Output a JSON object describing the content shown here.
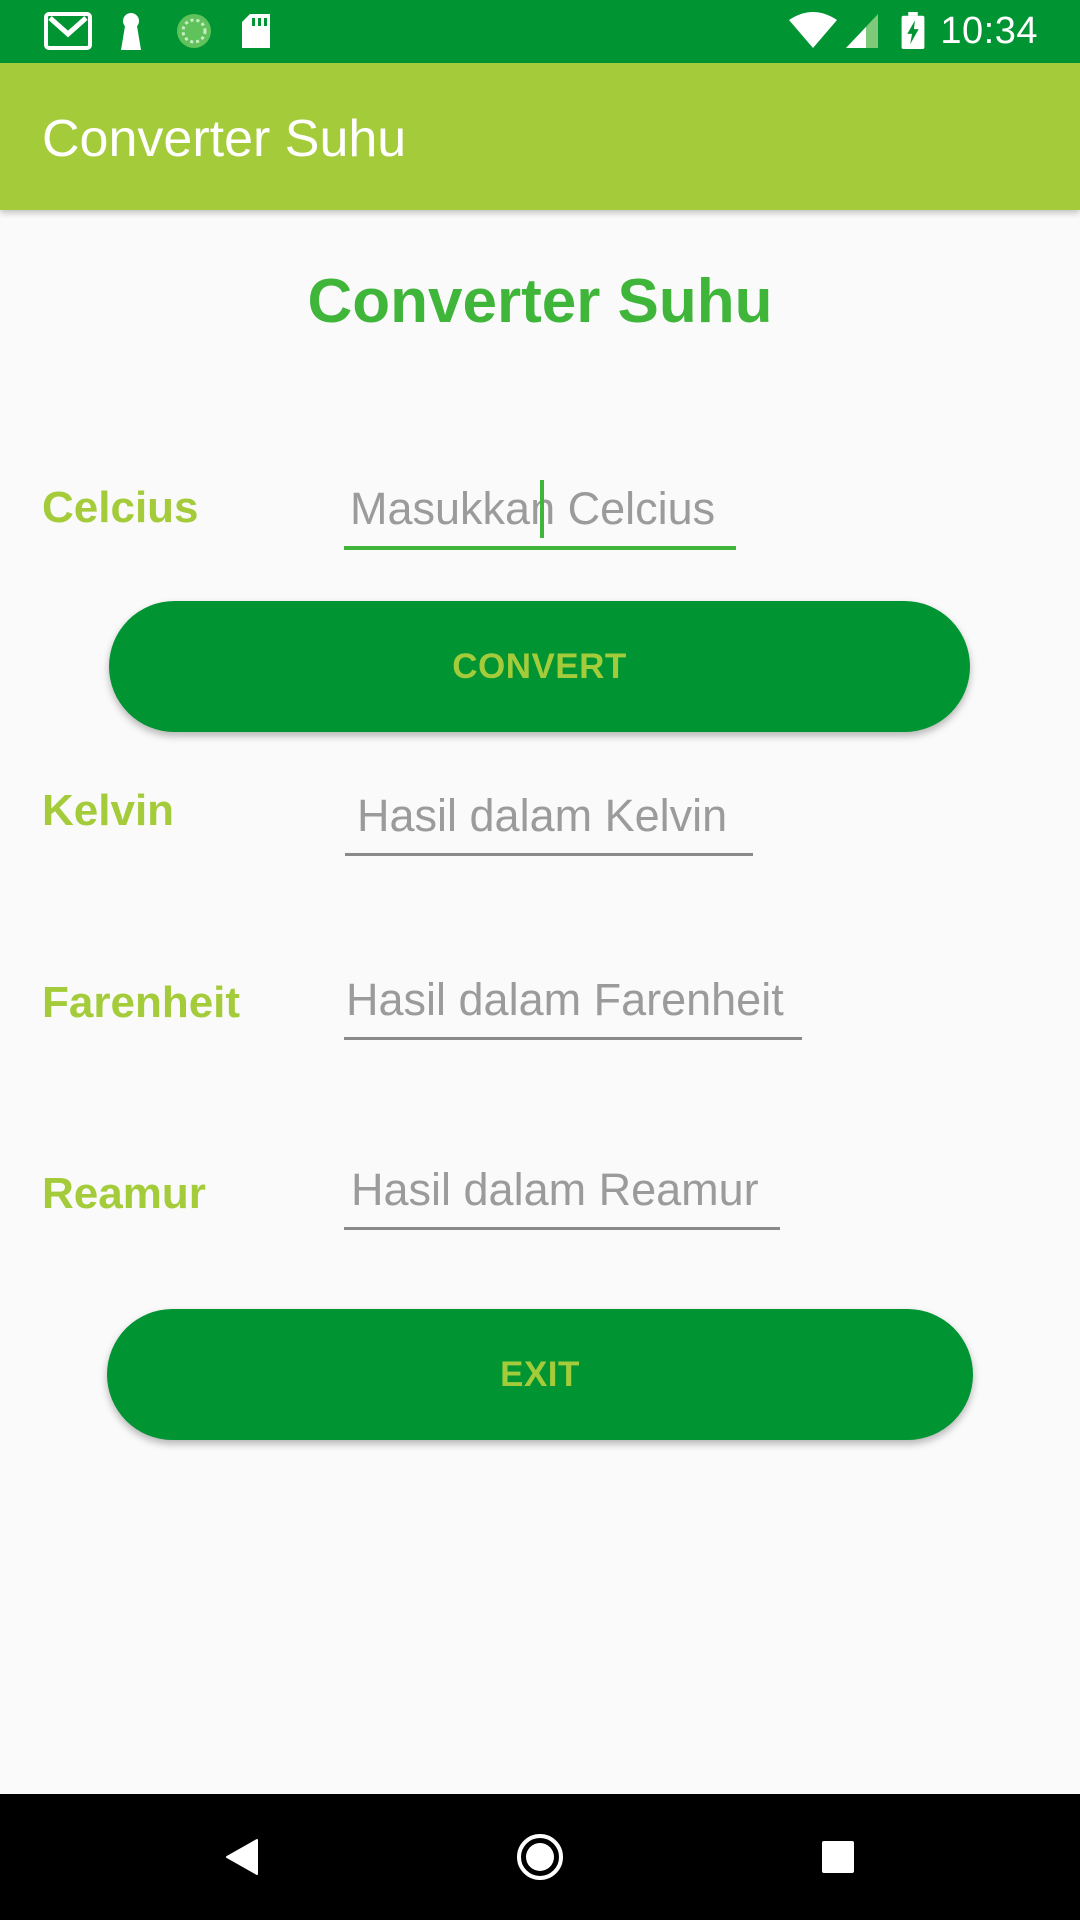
{
  "status_bar": {
    "time": "10:34",
    "icons_left": [
      "gmail-icon",
      "keyhole-icon",
      "sync-icon",
      "sd-card-icon"
    ],
    "icons_right": [
      "wifi-icon",
      "signal-icon",
      "battery-charging-icon"
    ]
  },
  "app_bar": {
    "title": "Converter Suhu"
  },
  "main": {
    "heading": "Converter Suhu",
    "celcius": {
      "label": "Celcius",
      "placeholder": "Masukkan Celcius",
      "value": ""
    },
    "convert_button": "CONVERT",
    "kelvin": {
      "label": "Kelvin",
      "placeholder": "Hasil dalam Kelvin"
    },
    "farenheit": {
      "label": "Farenheit",
      "placeholder": "Hasil dalam Farenheit"
    },
    "reamur": {
      "label": "Reamur",
      "placeholder": "Hasil dalam Reamur"
    },
    "exit_button": "EXIT"
  },
  "nav_bar": {
    "buttons": [
      "back-icon",
      "home-icon",
      "recents-icon"
    ]
  },
  "colors": {
    "status_bar": "#009432",
    "app_bar": "#a4cc3a",
    "heading": "#3fb53a",
    "label": "#a4cc3a",
    "button_bg": "#009432",
    "button_text": "#a4cc3a"
  }
}
